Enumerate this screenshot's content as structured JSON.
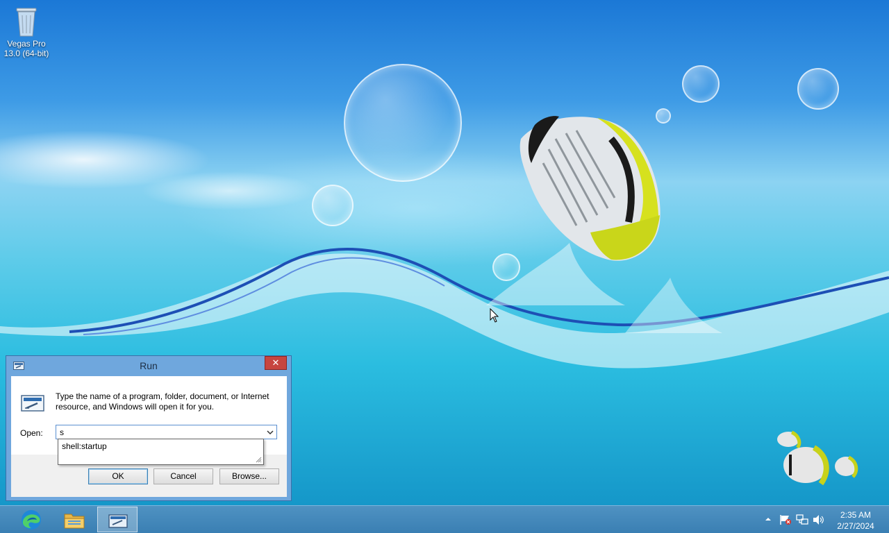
{
  "desktop": {
    "icons": [
      {
        "label": "Vegas Pro 13.0 (64-bit)",
        "icon": "recycle-bin-icon"
      }
    ]
  },
  "run_dialog": {
    "title": "Run",
    "close_label": "✕",
    "description": "Type the name of a program, folder, document, or Internet resource, and Windows will open it for you.",
    "open_label": "Open:",
    "open_value": "s",
    "autocomplete": [
      "shell:startup"
    ],
    "buttons": {
      "ok": "OK",
      "cancel": "Cancel",
      "browse": "Browse..."
    }
  },
  "taskbar": {
    "pinned": [
      {
        "name": "Microsoft Edge",
        "icon": "edge-icon"
      },
      {
        "name": "File Explorer",
        "icon": "folder-icon"
      },
      {
        "name": "Run",
        "icon": "run-icon",
        "active": true
      }
    ],
    "tray": {
      "overflow_icon": "chevron-up-icon",
      "icons": [
        "action-center-flag-icon",
        "network-icon",
        "volume-icon"
      ]
    },
    "clock": {
      "time": "2:35 AM",
      "date": "2/27/2024"
    }
  },
  "colors": {
    "taskbar": "#3a7fb3",
    "dialog_frame": "#6fa7dd",
    "close_button": "#c7453f"
  }
}
